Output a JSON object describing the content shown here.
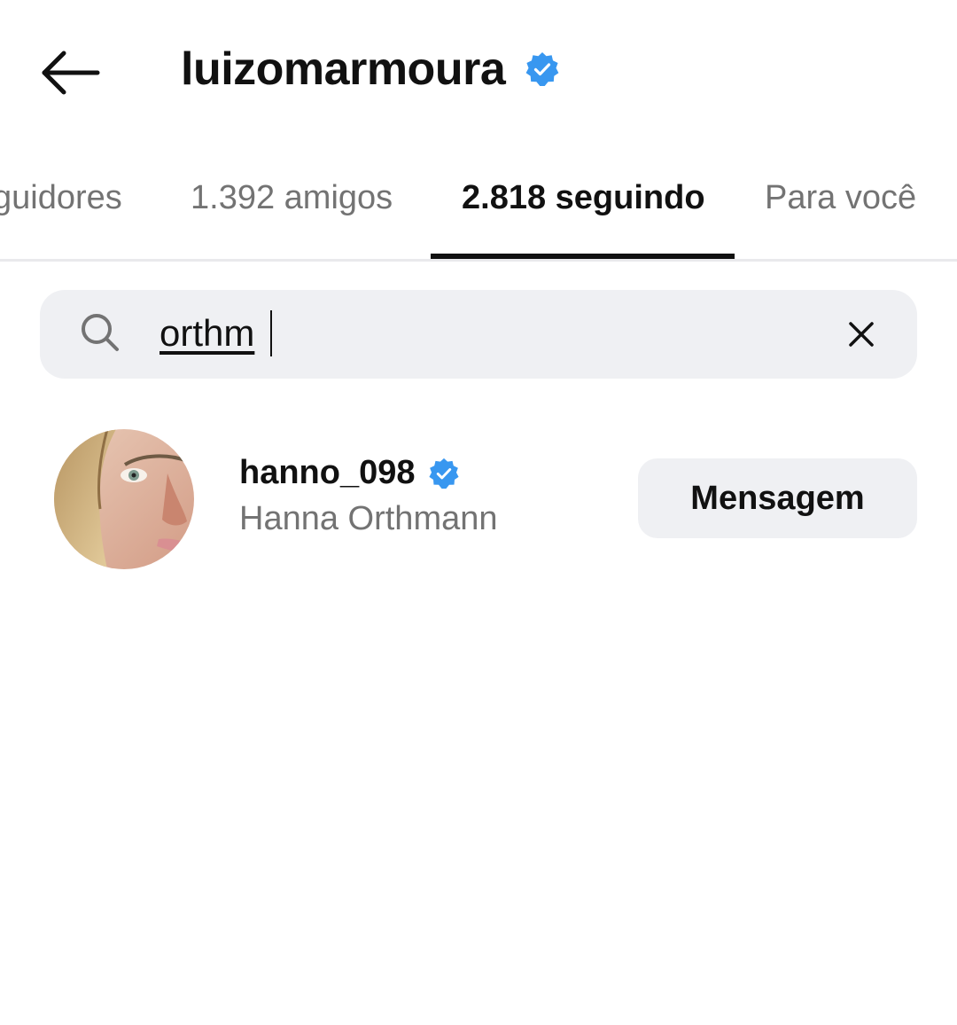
{
  "header": {
    "title": "luizomarmoura",
    "verified": true
  },
  "tabs": [
    {
      "label": "guidores",
      "active": false
    },
    {
      "label": "1.392 amigos",
      "active": false
    },
    {
      "label": "2.818 seguindo",
      "active": true
    },
    {
      "label": "Para você",
      "active": false
    }
  ],
  "search": {
    "value": "orthm",
    "icon": "search-icon",
    "clear_icon": "close-icon"
  },
  "results": [
    {
      "username": "hanno_098",
      "full_name": "Hanna Orthmann",
      "verified": true,
      "action_label": "Mensagem"
    }
  ],
  "colors": {
    "verified": "#3897f0",
    "text_primary": "#111111",
    "text_secondary": "#737373",
    "surface": "#eff0f3"
  }
}
